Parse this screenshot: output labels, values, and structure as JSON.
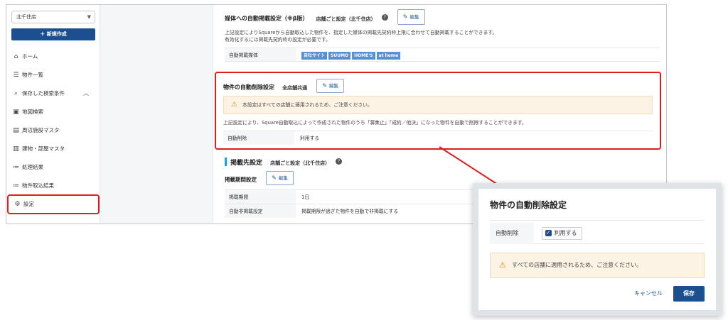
{
  "sidebar": {
    "store_select": "北千住店",
    "new_button": "＋ 新規作成",
    "items": [
      {
        "label": "ホーム",
        "icon": "home-icon"
      },
      {
        "label": "物件一覧",
        "icon": "list-icon"
      },
      {
        "label": "保存した検索条件",
        "icon": "saved-search-icon",
        "expanded": true
      },
      {
        "label": "地図検索",
        "icon": "map-icon"
      },
      {
        "label": "周辺施設マスタ",
        "icon": "facility-icon"
      },
      {
        "label": "建物・部屋マスタ",
        "icon": "building-icon"
      },
      {
        "label": "処理結果",
        "icon": "result-list-icon"
      },
      {
        "label": "物件取込結果",
        "icon": "import-result-icon"
      },
      {
        "label": "設定",
        "icon": "gear-icon",
        "active": true
      }
    ]
  },
  "media_section": {
    "title": "媒体への自動掲載設定（※β版）",
    "scope_tag": "店舗ごと設定（北千住店）",
    "edit_label": "編集",
    "description_1": "上記設定によりSquareから自動取込した物件を、指定した媒体の掲載先契約枠上限に合わせて自動掲載することができます。",
    "description_2": "有効化するには掲載先契約枠の設定が必要です。",
    "row_label": "自動掲載媒体",
    "media": [
      "自社サイト",
      "SUUMO",
      "HOME'S",
      "at home"
    ]
  },
  "auto_delete_section": {
    "title": "物件の自動削除設定",
    "scope_tag": "全店舗共通",
    "edit_label": "編集",
    "warning": "本設定はすべての店舗に適用されるため、ご注意ください。",
    "description": "上記設定により、Square自動取込によって作成された物件のうち「募集止」「成約／他決」になった物件を自動で削除することができます。",
    "row_label": "自動削除",
    "row_value": "利用する"
  },
  "listing_section": {
    "title": "掲載先設定",
    "scope_tag": "店舗ごと設定（北千住店）",
    "period_title": "掲載期間設定",
    "edit_label": "編集",
    "rows": [
      {
        "label": "掲載期間",
        "value": "1日"
      },
      {
        "label": "自動非掲載設定",
        "value": "掲載期限が過ぎた物件を自動で非掲載にする"
      }
    ]
  },
  "modal": {
    "title": "物件の自動削除設定",
    "row_label": "自動削除",
    "checkbox_label": "利用する",
    "checked": true,
    "warning": "すべての店舗に適用されるため、ご注意ください。",
    "cancel_label": "キャンセル",
    "save_label": "保存"
  },
  "colors": {
    "primary": "#1b4f8f",
    "highlight": "#e21b1b",
    "warning_bg": "#fdf3e4",
    "chip": "#5a8fd6"
  }
}
